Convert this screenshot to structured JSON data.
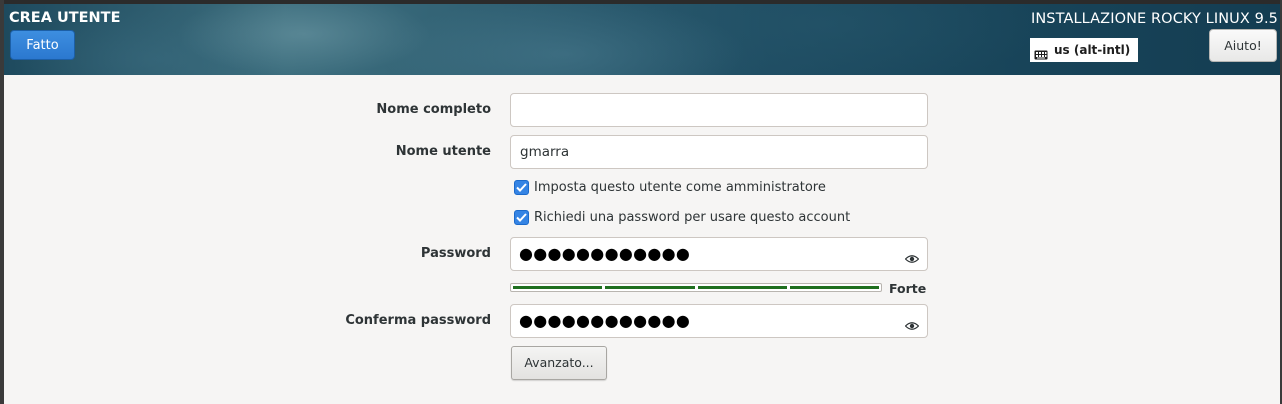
{
  "header": {
    "spoke_title": "CREA UTENTE",
    "done_label": "Fatto",
    "install_title": "INSTALLAZIONE ROCKY LINUX 9.5",
    "keyboard_layout": "us (alt-intl)",
    "keyboard_icon": "keyboard-icon",
    "help_label": "Aiuto!"
  },
  "form": {
    "fullname_label": "Nome completo",
    "fullname_value": "",
    "username_label": "Nome utente",
    "username_value": "gmarra",
    "admin_checkbox_label": "Imposta questo utente come amministratore",
    "admin_checked": true,
    "require_password_label": "Richiedi una password per usare questo account",
    "require_password_checked": true,
    "password_label": "Password",
    "password_mask": "●●●●●●●●●●●●",
    "strength_level": 1.0,
    "strength_label": "Forte",
    "confirm_label": "Conferma password",
    "confirm_mask": "●●●●●●●●●●●●",
    "advanced_label": "Avanzato..."
  },
  "colors": {
    "accent": "#3584e4",
    "strength_bar": "#1f6f1f",
    "background": "#f6f5f4"
  }
}
